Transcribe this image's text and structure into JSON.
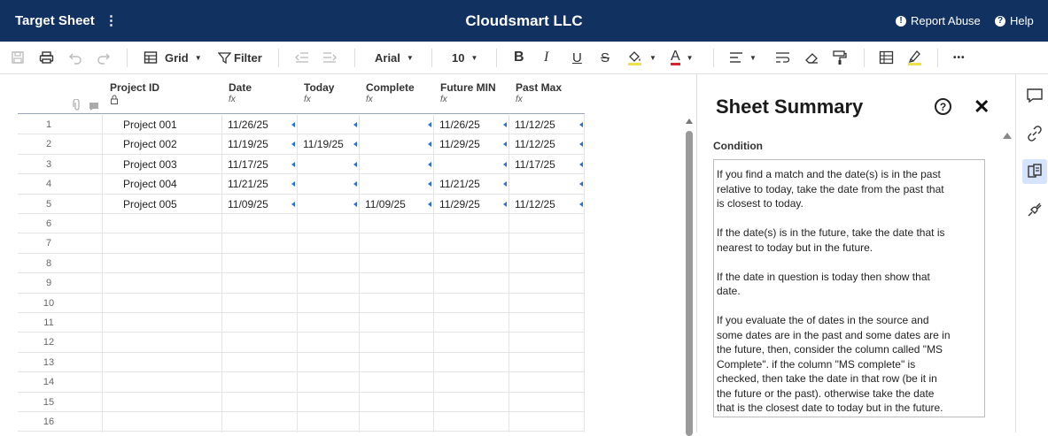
{
  "header": {
    "sheet_name": "Target Sheet",
    "sheet_menu": "⋮",
    "company": "Cloudsmart LLC",
    "report_abuse": "Report Abuse",
    "help": "Help"
  },
  "toolbar": {
    "view_label": "Grid",
    "filter_label": "Filter",
    "font": "Arial",
    "font_size": "10",
    "bold": "B",
    "italic": "I",
    "underline": "U",
    "strike": "S",
    "text_color_glyph": "A",
    "more": "•••"
  },
  "grid": {
    "columns": [
      {
        "name": "Project ID",
        "sub": ""
      },
      {
        "name": "Date",
        "sub": "fx"
      },
      {
        "name": "Today",
        "sub": "fx"
      },
      {
        "name": "Complete",
        "sub": "fx"
      },
      {
        "name": "Future MIN",
        "sub": "fx"
      },
      {
        "name": "Past Max",
        "sub": "fx"
      }
    ],
    "rows": [
      {
        "num": "1",
        "project": "Project 001",
        "date": "11/26/25",
        "today": "",
        "complete": "",
        "future_min": "11/26/25",
        "past_max": "11/12/25"
      },
      {
        "num": "2",
        "project": "Project 002",
        "date": "11/19/25",
        "today": "11/19/25",
        "complete": "",
        "future_min": "11/29/25",
        "past_max": "11/12/25"
      },
      {
        "num": "3",
        "project": "Project 003",
        "date": "11/17/25",
        "today": "",
        "complete": "",
        "future_min": "",
        "past_max": "11/17/25"
      },
      {
        "num": "4",
        "project": "Project 004",
        "date": "11/21/25",
        "today": "",
        "complete": "",
        "future_min": "11/21/25",
        "past_max": ""
      },
      {
        "num": "5",
        "project": "Project 005",
        "date": "11/09/25",
        "today": "",
        "complete": "11/09/25",
        "future_min": "11/29/25",
        "past_max": "11/12/25"
      },
      {
        "num": "6",
        "project": "",
        "date": "",
        "today": "",
        "complete": "",
        "future_min": "",
        "past_max": ""
      },
      {
        "num": "7",
        "project": "",
        "date": "",
        "today": "",
        "complete": "",
        "future_min": "",
        "past_max": ""
      },
      {
        "num": "8",
        "project": "",
        "date": "",
        "today": "",
        "complete": "",
        "future_min": "",
        "past_max": ""
      },
      {
        "num": "9",
        "project": "",
        "date": "",
        "today": "",
        "complete": "",
        "future_min": "",
        "past_max": ""
      },
      {
        "num": "10",
        "project": "",
        "date": "",
        "today": "",
        "complete": "",
        "future_min": "",
        "past_max": ""
      },
      {
        "num": "11",
        "project": "",
        "date": "",
        "today": "",
        "complete": "",
        "future_min": "",
        "past_max": ""
      },
      {
        "num": "12",
        "project": "",
        "date": "",
        "today": "",
        "complete": "",
        "future_min": "",
        "past_max": ""
      },
      {
        "num": "13",
        "project": "",
        "date": "",
        "today": "",
        "complete": "",
        "future_min": "",
        "past_max": ""
      },
      {
        "num": "14",
        "project": "",
        "date": "",
        "today": "",
        "complete": "",
        "future_min": "",
        "past_max": ""
      },
      {
        "num": "15",
        "project": "",
        "date": "",
        "today": "",
        "complete": "",
        "future_min": "",
        "past_max": ""
      },
      {
        "num": "16",
        "project": "",
        "date": "",
        "today": "",
        "complete": "",
        "future_min": "",
        "past_max": ""
      }
    ]
  },
  "summary": {
    "title": "Sheet Summary",
    "help_glyph": "?",
    "close_glyph": "✕",
    "field_label": "Condition",
    "condition_text": "If you find a match and the date(s) is in the past\nrelative to today, take the date from the past that\nis closest to today.\n\nIf the date(s) is in the future, take the date that is\nnearest to today but in the future.\n\nIf the date in question is today then show that\ndate.\n\nIf you evaluate the of dates in the source and\nsome dates are in the past and some dates are in\nthe future, then, consider the column called \"MS\nComplete\". if the column \"MS complete\" is\nchecked, then take the date in that row (be it in\nthe future or the past). otherwise take the date\nthat is the closest date to today but in the future."
  },
  "colors": {
    "header_bg": "#113160",
    "accent": "#2a6fd6",
    "rail_active": "#d6e4fb"
  }
}
